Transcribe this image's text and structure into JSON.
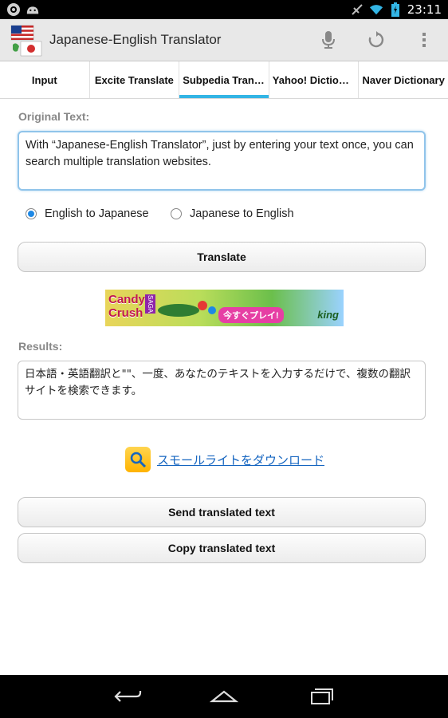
{
  "status_bar": {
    "time": "23:11",
    "left_icons": [
      "steam-icon",
      "android-icon"
    ],
    "right_icons": [
      "signal-off-icon",
      "wifi-icon",
      "battery-charging-icon"
    ]
  },
  "action_bar": {
    "title": "Japanese-English Translator",
    "actions": [
      "microphone-icon",
      "refresh-icon",
      "overflow-menu-icon"
    ]
  },
  "tabs": [
    {
      "label": "Input",
      "active": false
    },
    {
      "label": "Excite Translate",
      "active": false
    },
    {
      "label": "Subpedia Trans…",
      "active": true
    },
    {
      "label": "Yahoo! Diction…",
      "active": false
    },
    {
      "label": "Naver Dictionary",
      "active": false
    }
  ],
  "original": {
    "label": "Original Text:",
    "value": "With “Japanese-English Translator”, just by entering your text once, you can search multiple translation websites."
  },
  "direction": {
    "options": [
      {
        "label": "English to Japanese",
        "checked": true
      },
      {
        "label": "Japanese to English",
        "checked": false
      }
    ]
  },
  "translate_button": "Translate",
  "ad": {
    "brand": "Candy Crush",
    "saga": "SAGA",
    "cta": "今すぐプレイ!",
    "company": "king"
  },
  "results": {
    "label": "Results:",
    "value": "日本語・英語翻訳と\"\"、一度、あなたのテキストを入力するだけで、複数の翻訳サイトを検索できます。"
  },
  "promo": {
    "link_text": "スモールライトをダウンロード"
  },
  "send_button": "Send translated text",
  "copy_button": "Copy translated text",
  "colors": {
    "tab_indicator": "#33b5e5",
    "link": "#1565c0",
    "radio_selected": "#1e88e5"
  }
}
